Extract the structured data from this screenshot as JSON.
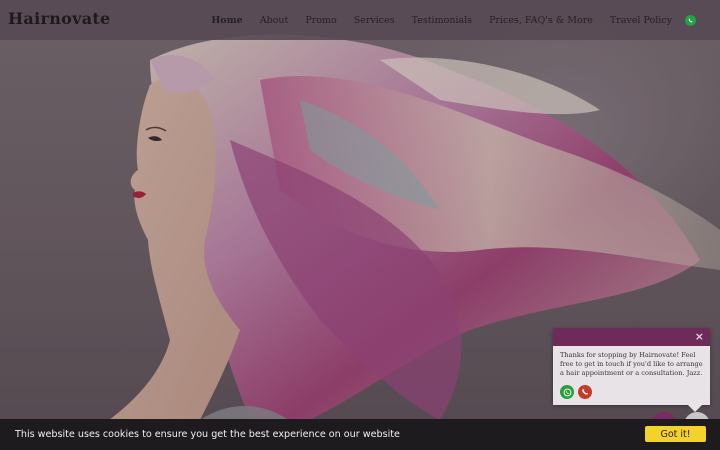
{
  "header": {
    "brand": "Hairnovate",
    "nav": [
      {
        "label": "Home",
        "active": true
      },
      {
        "label": "About"
      },
      {
        "label": "Promo"
      },
      {
        "label": "Services"
      },
      {
        "label": "Testimonials"
      },
      {
        "label": "Prices, FAQ's & More"
      },
      {
        "label": "Travel Policy"
      }
    ],
    "whatsapp_icon": "whatsapp-icon"
  },
  "hero": {
    "image": "woman-with-colorful-flowing-hair",
    "colors": {
      "pink": "#b0477e",
      "purple": "#8c4ea0",
      "blonde": "#e8dccc",
      "teal": "#8fb8b8"
    }
  },
  "chat": {
    "close_symbol": "×",
    "message": "Thanks for stopping by Hairnovate! Feel free to get in touch if you'd like to arrange a hair appointment or a consultation. Jazz.",
    "icons": [
      "whatsapp-icon",
      "phone-icon"
    ],
    "header_color": "#6e2a58"
  },
  "cookie": {
    "text": "This website uses cookies to ensure you get the best experience on our website",
    "button": "Got it!",
    "button_color": "#f3d22a"
  }
}
